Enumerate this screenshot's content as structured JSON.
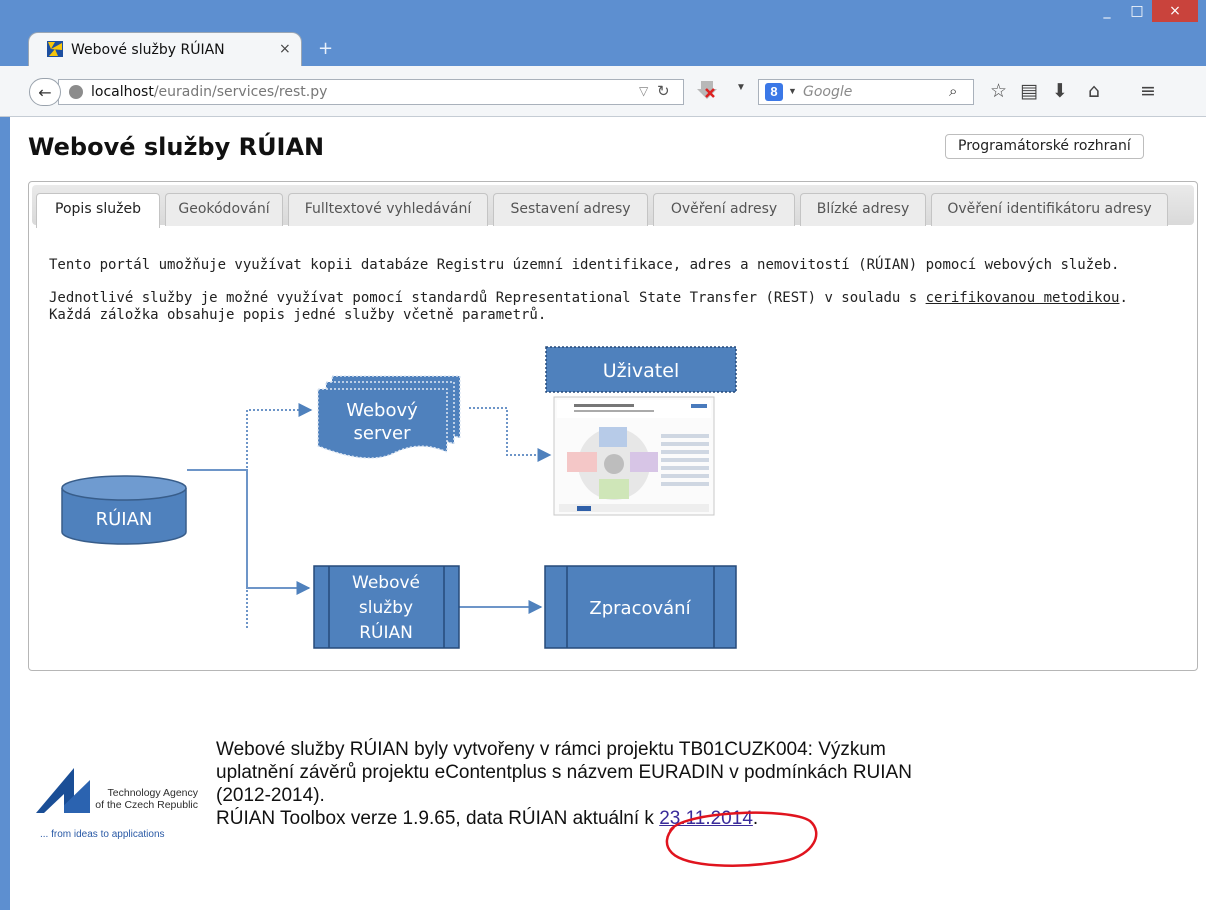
{
  "browser": {
    "tab_title": "Webové služby RÚIAN",
    "tab_close": "×",
    "new_tab": "+",
    "url_host": "localhost",
    "url_path": "/euradin/services/rest.py",
    "search_placeholder": "Google",
    "window_controls": {
      "minimize": "_",
      "maximize": "□",
      "close": "×"
    }
  },
  "page": {
    "title": "Webové služby RÚIAN",
    "api_button": "Programátorské rozhraní",
    "tabs": [
      {
        "label": "Popis služeb",
        "active": true
      },
      {
        "label": "Geokódování",
        "active": false
      },
      {
        "label": "Fulltextové vyhledávání",
        "active": false
      },
      {
        "label": "Sestavení adresy",
        "active": false
      },
      {
        "label": "Ověření adresy",
        "active": false
      },
      {
        "label": "Blízké adresy",
        "active": false
      },
      {
        "label": "Ověření identifikátoru adresy",
        "active": false
      }
    ],
    "intro": {
      "p1": "Tento portál umožňuje využívat kopii databáze Registru územní identifikace, adres a nemovitostí (RÚIAN) pomocí webových služeb.",
      "p2_before": "Jednotlivé služby je možné využívat pomocí standardů Representational State Transfer (REST) v souladu s ",
      "p2_link": "cerifikovanou metodikou",
      "p2_after": ". Každá záložka obsahuje popis jedné služby včetně parametrů."
    },
    "diagram": {
      "database": "RÚIAN",
      "web_server_line1": "Webový",
      "web_server_line2": "server",
      "user": "Uživatel",
      "services_line1": "Webové",
      "services_line2": "služby",
      "services_line3": "RÚIAN",
      "processing": "Zpracování"
    },
    "footer": {
      "logo_line1": "Technology Agency",
      "logo_line2": "of the Czech Republic",
      "logo_tagline": "... from ideas to applications",
      "line1": "Webové služby RÚIAN byly vytvořeny v rámci projektu TB01CUZK004: Výzkum",
      "line2": "uplatnění závěrů projektu eContentplus s názvem EURADIN v podmínkách RUIAN",
      "line3": "(2012-2014).",
      "line4_before": "RÚIAN Toolbox verze 1.9.65, data RÚIAN aktuální k ",
      "date": "23.11.2014",
      "line4_after": "."
    }
  },
  "colors": {
    "titlebar": "#5d8fd0",
    "diagram_fill": "#4f81bd",
    "diagram_stroke": "#385d8a",
    "annotation": "#e0141e"
  }
}
